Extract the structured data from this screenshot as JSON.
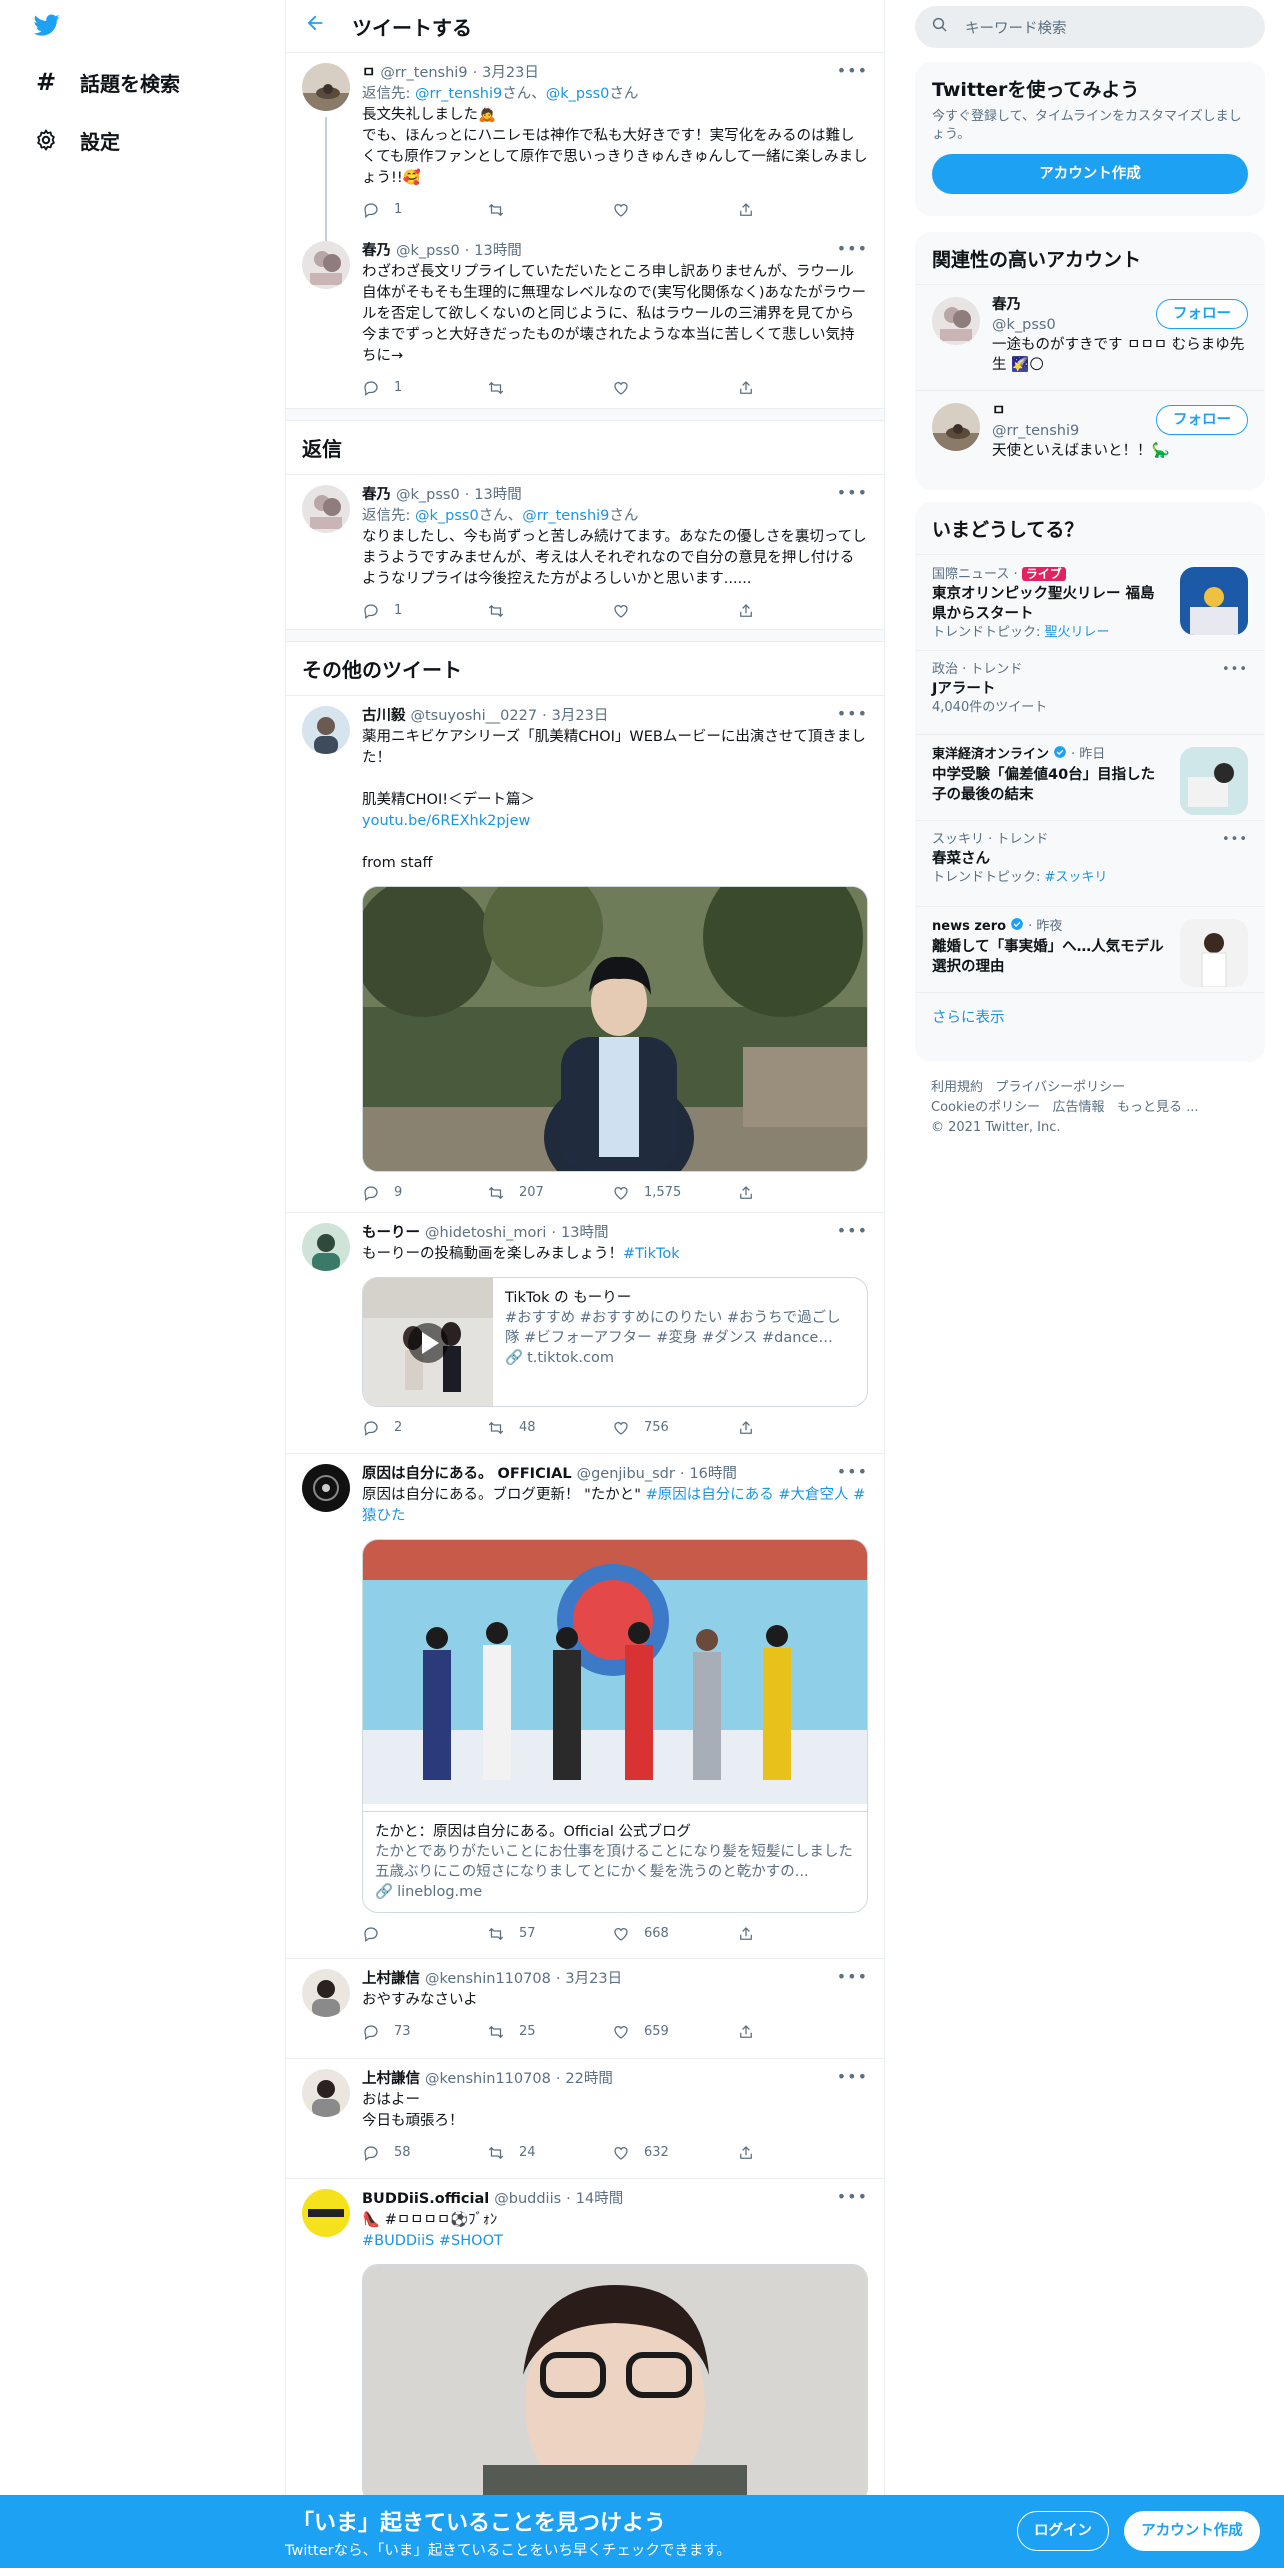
{
  "nav": {
    "explore_label": "話題を検索",
    "settings_label": "設定"
  },
  "header": {
    "title": "ツイートする"
  },
  "thread": [
    {
      "name": "ㅁ",
      "handle": "@rr_tenshi9",
      "time": "3月23日",
      "reply_prefix": "返信先:",
      "reply_to_1": "@rr_tenshi9",
      "reply_to_sep": "さん、",
      "reply_to_2": "@k_pss0",
      "reply_to_suffix": "さん",
      "text": "長文失礼しました🙇\nでも、ほんっとにハニレモは神作で私も大好きです！実写化をみるのは難しくても原作ファンとして原作で思いっきりきゅんきゅんして一緒に楽しみましょう!!🥰",
      "replies": "1",
      "retweets": "",
      "likes": ""
    },
    {
      "name": "春乃",
      "handle": "@k_pss0",
      "time": "13時間",
      "text": "わざわざ長文リプライしていただいたところ申し訳ありませんが、ラウール自体がそもそも生理的に無理なレベルなので(実写化関係なく)あなたがラウールを否定して欲しくないのと同じように、私はラウールの三浦界を見てから今までずっと大好きだったものが壊されたような本当に苦しくて悲しい気持ちに→",
      "replies": "1",
      "retweets": "",
      "likes": ""
    }
  ],
  "replies_section": {
    "title": "返信",
    "tweet": {
      "name": "春乃",
      "handle": "@k_pss0",
      "time": "13時間",
      "reply_prefix": "返信先:",
      "reply_to_1": "@k_pss0",
      "reply_to_sep": "さん、",
      "reply_to_2": "@rr_tenshi9",
      "reply_to_suffix": "さん",
      "text": "なりましたし、今も尚ずっと苦しみ続けてます。あなたの優しさを裏切ってしまうようですみませんが、考えは人それぞれなので自分の意見を押し付けるようなリプライは今後控えた方がよろしいかと思います......",
      "replies": "1",
      "retweets": "",
      "likes": ""
    }
  },
  "other_section": {
    "title": "その他のツイート",
    "tweets": [
      {
        "name": "古川毅",
        "handle": "@tsuyoshi__0227",
        "time": "3月23日",
        "text": "薬用ニキビケアシリーズ「肌美精CHOI」WEBムービーに出演させて頂きました！\n\n肌美精CHOI!＜デート篇＞",
        "link": "youtu.be/6REXhk2pjew",
        "text2": "from staff",
        "replies": "9",
        "retweets": "207",
        "likes": "1,575"
      },
      {
        "name": "もーりー",
        "handle": "@hidetoshi_mori",
        "time": "13時間",
        "text": "もーりーの投稿動画を楽しみましょう！",
        "hashtag": "#TikTok",
        "card_title": "TikTok の もーりー",
        "card_desc": "#おすすめ #おすすめにのりたい #おうちで過ごし隊 #ビフォーアフター #変身 #ダンス #dance #TikTo...",
        "card_domain": "t.tiktok.com",
        "replies": "2",
        "retweets": "48",
        "likes": "756"
      },
      {
        "name": "原因は自分にある。 OFFICIAL",
        "handle": "@genjibu_sdr",
        "time": "16時間",
        "text": "原因は自分にある。ブログ更新！ \"たかと\"",
        "hashtags": "#原因は自分にある #大倉空人 #猿ひた",
        "card_title": "たかと：原因は自分にある。Official 公式ブログ",
        "card_desc": "たかとでありがたいことにお仕事を頂けることになり髪を短髪にしました五歳ぶりにこの短さになりましてとにかく髪を洗うのと乾かすの...",
        "card_domain": "lineblog.me",
        "replies": "",
        "retweets": "57",
        "likes": "668"
      },
      {
        "name": "上村謙信",
        "handle": "@kenshin110708",
        "time": "3月23日",
        "text": "おやすみなさいよ",
        "replies": "73",
        "retweets": "25",
        "likes": "659"
      },
      {
        "name": "上村謙信",
        "handle": "@kenshin110708",
        "time": "22時間",
        "text": "おはよー\n今日も頑張ろ！",
        "replies": "58",
        "retweets": "24",
        "likes": "632"
      },
      {
        "name": "BUDDiiS.official",
        "handle": "@buddiis",
        "time": "14時間",
        "text": "👠 #ㅁㅁㅁㅁ⚽ﾌﾞｫﾝ",
        "hashtags": "#BUDDiiS #SHOOT",
        "replies": "",
        "retweets": "",
        "likes": ""
      }
    ]
  },
  "right": {
    "search_placeholder": "キーワード検索",
    "signup_panel": {
      "title": "Twitterを使ってみよう",
      "desc": "今すぐ登録して、タイムラインをカスタマイズしましょう。",
      "button": "アカウント作成"
    },
    "related": {
      "title": "関連性の高いアカウント",
      "accounts": [
        {
          "name": "春乃",
          "handle": "@k_pss0",
          "bio": "一途ものがすきです ㅁㅁㅁ むらまゆ先生 🌠🌕",
          "follow": "フォロー"
        },
        {
          "name": "ㅁ",
          "handle": "@rr_tenshi9",
          "bio": "天使といえばまいと！！🦕",
          "follow": "フォロー"
        }
      ]
    },
    "trends": {
      "title": "いまどうしてる？",
      "items": [
        {
          "category": "国際ニュース · ",
          "live": "ライブ",
          "title": "東京オリンピック聖火リレー 福島県からスタート",
          "sub_prefix": "トレンドトピック: ",
          "sub_link": "聖火リレー"
        },
        {
          "category": "政治 · トレンド",
          "title": "Jアラート",
          "count": "4,040件のツイート"
        },
        {
          "source": "東洋経済オンライン",
          "time": " · 昨日",
          "title": "中学受験「偏差値40台」目指した子の最後の結末"
        },
        {
          "category": "スッキリ · トレンド",
          "title": "春菜さん",
          "sub_prefix": "トレンドトピック: ",
          "sub_link": "#スッキリ"
        },
        {
          "source": "news zero",
          "time": " · 昨夜",
          "title": "離婚して「事実婚」へ…人気モデル選択の理由"
        }
      ],
      "show_more": "さらに表示"
    },
    "footer": {
      "l1a": "利用規約",
      "l1b": "プライバシーポリシー",
      "l2a": "Cookieのポリシー",
      "l2b": "広告情報",
      "l2c": "もっと見る ...",
      "copy": "© 2021 Twitter, Inc."
    }
  },
  "bottom_bar": {
    "headline": "「いま」起きていることを見つけよう",
    "sub": "Twitterなら、「いま」起きていることをいち早くチェックできます。",
    "login": "ログイン",
    "signup": "アカウント作成"
  },
  "colors": {
    "accent": "#1da1f2",
    "link": "#1b95e0",
    "live": "#e0245e"
  }
}
